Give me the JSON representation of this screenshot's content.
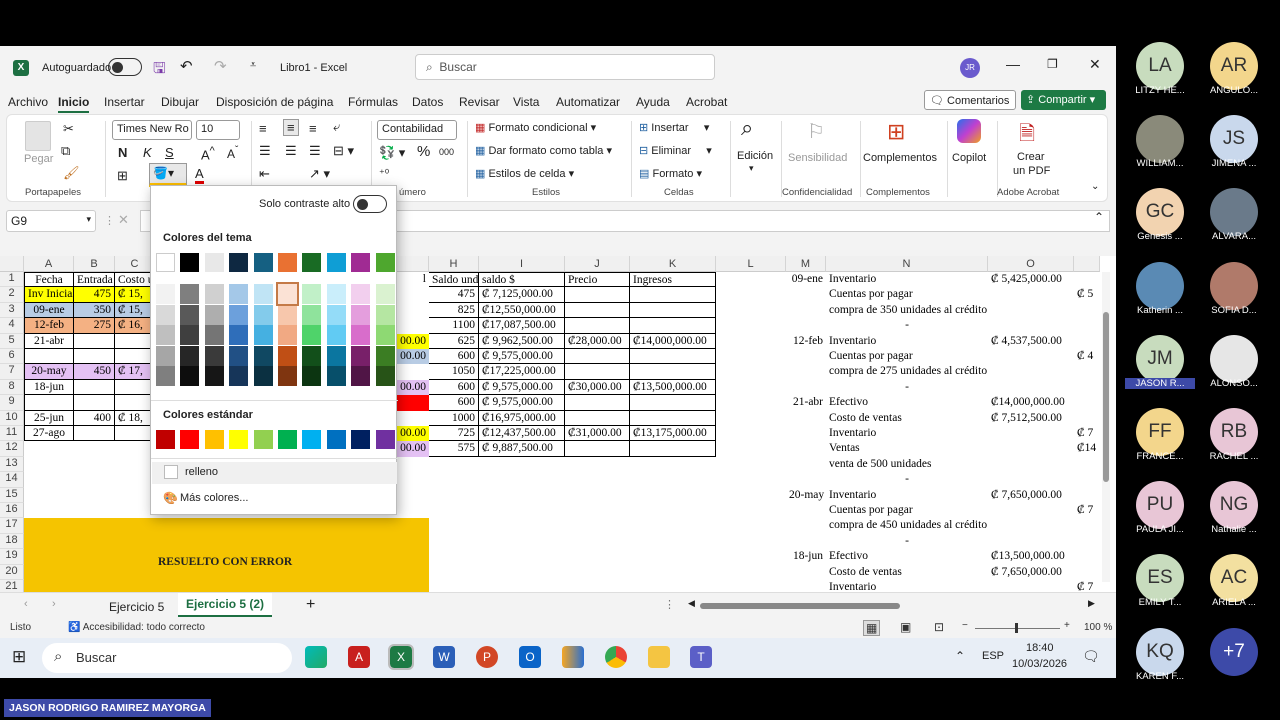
{
  "window": {
    "autosave_label": "Autoguardado",
    "doc_title": "Libro1 - Excel",
    "search_placeholder": "Buscar",
    "user_initials": "JR"
  },
  "menu": [
    "Archivo",
    "Inicio",
    "Insertar",
    "Dibujar",
    "Disposición de página",
    "Fórmulas",
    "Datos",
    "Revisar",
    "Vista",
    "Automatizar",
    "Ayuda",
    "Acrobat"
  ],
  "menu_actions": {
    "comments": "Comentarios",
    "share": "Compartir"
  },
  "ribbon": {
    "paste": "Pegar",
    "clipboard_group": "Portapapeles",
    "font_name": "Times New Ro",
    "font_size": "10",
    "number_format": "Contabilidad",
    "number_group": "úmero",
    "conditional": "Formato condicional",
    "table_format": "Dar formato como tabla",
    "cell_styles": "Estilos de celda",
    "styles_group": "Estilos",
    "insert": "Insertar",
    "delete": "Eliminar",
    "format": "Formato",
    "cells_group": "Celdas",
    "edit": "Edición",
    "sensitivity": "Sensibilidad",
    "confidentiality_group": "Confidencialidad",
    "addins": "Complementos",
    "addins_group": "Complementos",
    "copilot": "Copilot",
    "create_pdf_1": "Crear",
    "create_pdf_2": "un PDF",
    "acrobat_group": "Adobe Acrobat"
  },
  "namebox": "G9",
  "columns": [
    "A",
    "B",
    "C",
    "H",
    "I",
    "J",
    "K",
    "L",
    "M",
    "N",
    "O"
  ],
  "rows": [
    "1",
    "2",
    "3",
    "4",
    "5",
    "6",
    "7",
    "8",
    "9",
    "10",
    "11",
    "12",
    "13",
    "14",
    "15",
    "16",
    "17",
    "18",
    "19",
    "20",
    "21"
  ],
  "cells": {
    "A": [
      "Fecha",
      "Inv Inicial",
      "09-ene",
      "12-feb",
      "21-abr",
      "",
      "20-may",
      "18-jun",
      "",
      "25-jun",
      "27-ago"
    ],
    "B": [
      "Entrada",
      "475",
      "350",
      "275",
      "",
      "",
      "450",
      "",
      "",
      "400",
      ""
    ],
    "C": [
      "Costo u",
      "₡ 15,",
      "₡ 15,",
      "₡ 16,",
      "",
      "",
      "₡ 17,",
      "",
      "",
      "₡ 18,",
      ""
    ],
    "G": [
      "l",
      "",
      "",
      "",
      "00.00",
      "00.00",
      "",
      "00.00",
      "",
      "",
      "00.00",
      "00.00"
    ],
    "H": [
      "Saldo und",
      "475",
      "825",
      "1100",
      "625",
      "600",
      "1050",
      "600",
      "600",
      "1000",
      "725",
      "575"
    ],
    "I": [
      "saldo $",
      "₡ 7,125,000.00",
      "₡12,550,000.00",
      "₡17,087,500.00",
      "₡ 9,962,500.00",
      "₡ 9,575,000.00",
      "₡17,225,000.00",
      "₡ 9,575,000.00",
      "₡ 9,575,000.00",
      "₡16,975,000.00",
      "₡12,437,500.00",
      "₡ 9,887,500.00"
    ],
    "J": [
      "Precio",
      "",
      "",
      "",
      "₡28,000.00",
      "",
      "",
      "₡30,000.00",
      "",
      "",
      "₡31,000.00",
      ""
    ],
    "K": [
      "Ingresos",
      "",
      "",
      "",
      "₡14,000,000.00",
      "",
      "",
      "₡13,500,000.00",
      "",
      "",
      "₡13,175,000.00",
      ""
    ],
    "M": [
      "09-ene",
      "",
      "",
      "",
      "12-feb",
      "",
      "",
      "",
      "21-abr",
      "",
      "",
      "",
      "",
      "",
      "20-may",
      "",
      "",
      "",
      "18-jun",
      "",
      ""
    ],
    "N": [
      "Inventario",
      "Cuentas por pagar",
      "compra de 350 unidades al crédito",
      "-",
      "Inventario",
      "Cuentas por pagar",
      "compra de 275 unidades al crédito",
      "-",
      "Efectivo",
      "Costo de ventas",
      "Inventario",
      "Ventas",
      "venta de 500 unidades",
      "-",
      "Inventario",
      "Cuentas por pagar",
      "compra de 450 unidades al crédito",
      "-",
      "Efectivo",
      "Costo de ventas",
      "Inventario"
    ],
    "O": [
      "₡ 5,425,000.00",
      "",
      "",
      "",
      "₡ 4,537,500.00",
      "",
      "",
      "",
      "₡14,000,000.00",
      "₡ 7,512,500.00",
      "",
      "",
      "",
      "",
      "₡ 7,650,000.00",
      "",
      "",
      "",
      "₡13,500,000.00",
      "₡ 7,650,000.00",
      ""
    ],
    "P": [
      "",
      "₡ 5",
      "",
      "",
      "",
      "₡ 4",
      "",
      "",
      "",
      "",
      "₡ 7",
      "₡14",
      "",
      "",
      "",
      "₡ 7",
      "",
      "",
      "",
      "",
      "₡ 7"
    ]
  },
  "error_note": "RESUELTO CON ERROR",
  "popup": {
    "high_contrast": "Solo contraste alto",
    "theme_colors": "Colores del tema",
    "standard_colors": "Colores estándar",
    "no_fill": "relleno",
    "more_colors": "Más colores..."
  },
  "theme_top": [
    "#ffffff",
    "#000000",
    "#e8e8e8",
    "#0e2841",
    "#156082",
    "#e97132",
    "#196b24",
    "#0f9ed5",
    "#a02b93",
    "#4ea72e"
  ],
  "theme_shades": [
    [
      "#f2f2f2",
      "#7f7f7f",
      "#d0d0d0",
      "#a4c8e8",
      "#c0e4f5",
      "#fbe2d5",
      "#c1f0c8",
      "#caeefb",
      "#f2cfee",
      "#daf2d0"
    ],
    [
      "#d9d9d9",
      "#595959",
      "#aeaeae",
      "#6ca0dc",
      "#83cbeb",
      "#f7c7ac",
      "#8fe39c",
      "#94dcf8",
      "#e49edd",
      "#b5e6a2"
    ],
    [
      "#bfbfbf",
      "#3f3f3f",
      "#757575",
      "#2f6eba",
      "#45b0e1",
      "#f1a983",
      "#4fd36a",
      "#61cbf3",
      "#d86dcb",
      "#8ed973"
    ],
    [
      "#a6a6a6",
      "#262626",
      "#3a3a3a",
      "#215085",
      "#104862",
      "#c04f15",
      "#124f1a",
      "#0b76a0",
      "#782069",
      "#3b7d23"
    ],
    [
      "#7f7f7f",
      "#0d0d0d",
      "#161616",
      "#163559",
      "#0b3041",
      "#7f3510",
      "#0c3511",
      "#074f6a",
      "#501546",
      "#275317"
    ]
  ],
  "standard": [
    "#c00000",
    "#ff0000",
    "#ffc000",
    "#ffff00",
    "#92d050",
    "#00b050",
    "#00b0f0",
    "#0070c0",
    "#002060",
    "#7030a0"
  ],
  "sheets": [
    "Ejercicio 5",
    "Ejercicio 5 (2)"
  ],
  "status": {
    "ready": "Listo",
    "accessibility": "Accesibilidad: todo correcto",
    "zoom": "100 %"
  },
  "taskbar": {
    "search": "Buscar",
    "lang": "ESP",
    "time": "18:40",
    "date": "10/03/2026"
  },
  "participants": [
    {
      "initials": "LA",
      "name": "LITZY HE...",
      "color": "#c8dcbe"
    },
    {
      "initials": "AR",
      "name": "ANGULO...",
      "color": "#f3d68c"
    },
    {
      "initials": "",
      "name": "WILLIAM...",
      "color": "#8a8a7a"
    },
    {
      "initials": "JS",
      "name": "JIMENA ...",
      "color": "#c9d8ec"
    },
    {
      "initials": "GC",
      "name": "Genesis ...",
      "color": "#f2d3b0"
    },
    {
      "initials": "",
      "name": "ALVARA...",
      "color": "#6a7a8a"
    },
    {
      "initials": "",
      "name": "Katherin ...",
      "color": "#5a8ab4"
    },
    {
      "initials": "",
      "name": "SOFIA D...",
      "color": "#b07a6a"
    },
    {
      "initials": "JM",
      "name": "JASON R...",
      "color": "#c8dcbe"
    },
    {
      "initials": "",
      "name": "ALONSO...",
      "color": "#e6e6e6"
    },
    {
      "initials": "FF",
      "name": "FRANCE...",
      "color": "#f3d68c"
    },
    {
      "initials": "RB",
      "name": "RACHEL ...",
      "color": "#e8c6d6"
    },
    {
      "initials": "PU",
      "name": "PAULA JI...",
      "color": "#e8c6d6"
    },
    {
      "initials": "NG",
      "name": "Nathalie ...",
      "color": "#e8c6d6"
    },
    {
      "initials": "ES",
      "name": "EMILY T...",
      "color": "#c8dcbe"
    },
    {
      "initials": "AC",
      "name": "ARIELA ...",
      "color": "#f3e0a0"
    },
    {
      "initials": "KQ",
      "name": "KAREN F...",
      "color": "#c9d8ec"
    },
    {
      "initials": "+7",
      "name": "",
      "color": "#3d4aa8"
    }
  ],
  "caption": "JASON RODRIGO RAMIREZ MAYORGA"
}
